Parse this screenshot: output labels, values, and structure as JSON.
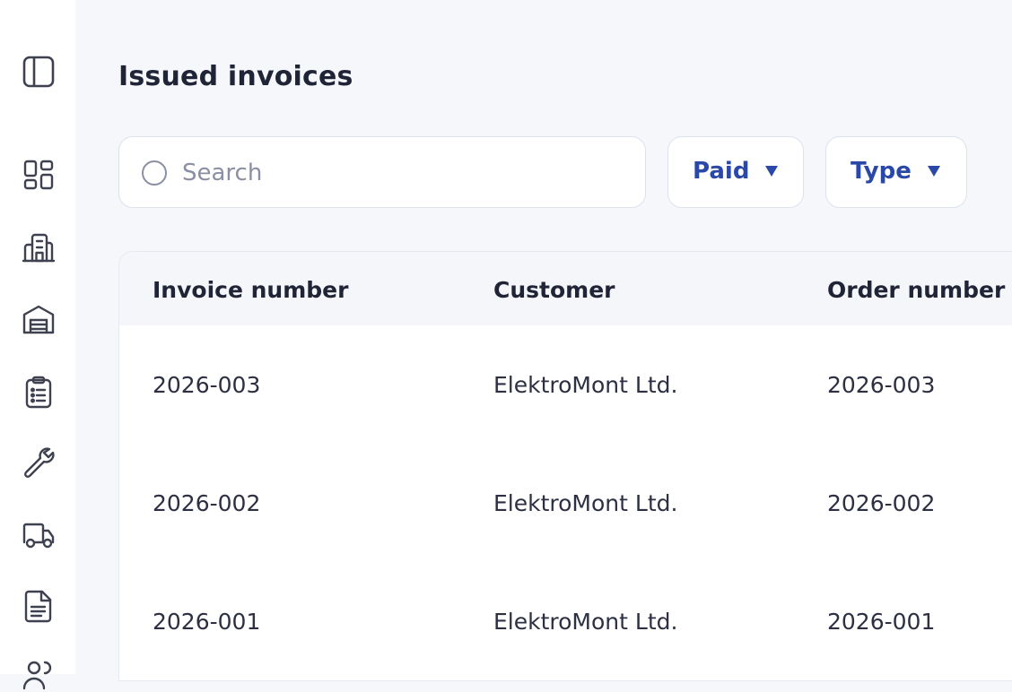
{
  "sidebar": {
    "items": [
      {
        "icon": "sidebar-toggle-icon"
      },
      {
        "icon": "dashboard-icon"
      },
      {
        "icon": "building-icon"
      },
      {
        "icon": "warehouse-icon"
      },
      {
        "icon": "clipboard-list-icon"
      },
      {
        "icon": "wrench-icon"
      },
      {
        "icon": "truck-icon"
      },
      {
        "icon": "document-icon"
      },
      {
        "icon": "users-icon"
      }
    ]
  },
  "page": {
    "title": "Issued invoices"
  },
  "search": {
    "placeholder": "Search",
    "value": ""
  },
  "filters": {
    "paid_label": "Paid",
    "type_label": "Type"
  },
  "table": {
    "columns": [
      "Invoice number",
      "Customer",
      "Order number"
    ],
    "rows": [
      [
        "2026-003",
        "ElektroMont Ltd.",
        "2026-003"
      ],
      [
        "2026-002",
        "ElektroMont Ltd.",
        "2026-002"
      ],
      [
        "2026-001",
        "ElektroMont Ltd.",
        "2026-001"
      ]
    ]
  },
  "colors": {
    "accent": "#2a48a8",
    "background": "#f6f7fb",
    "icon": "#3d4150"
  }
}
